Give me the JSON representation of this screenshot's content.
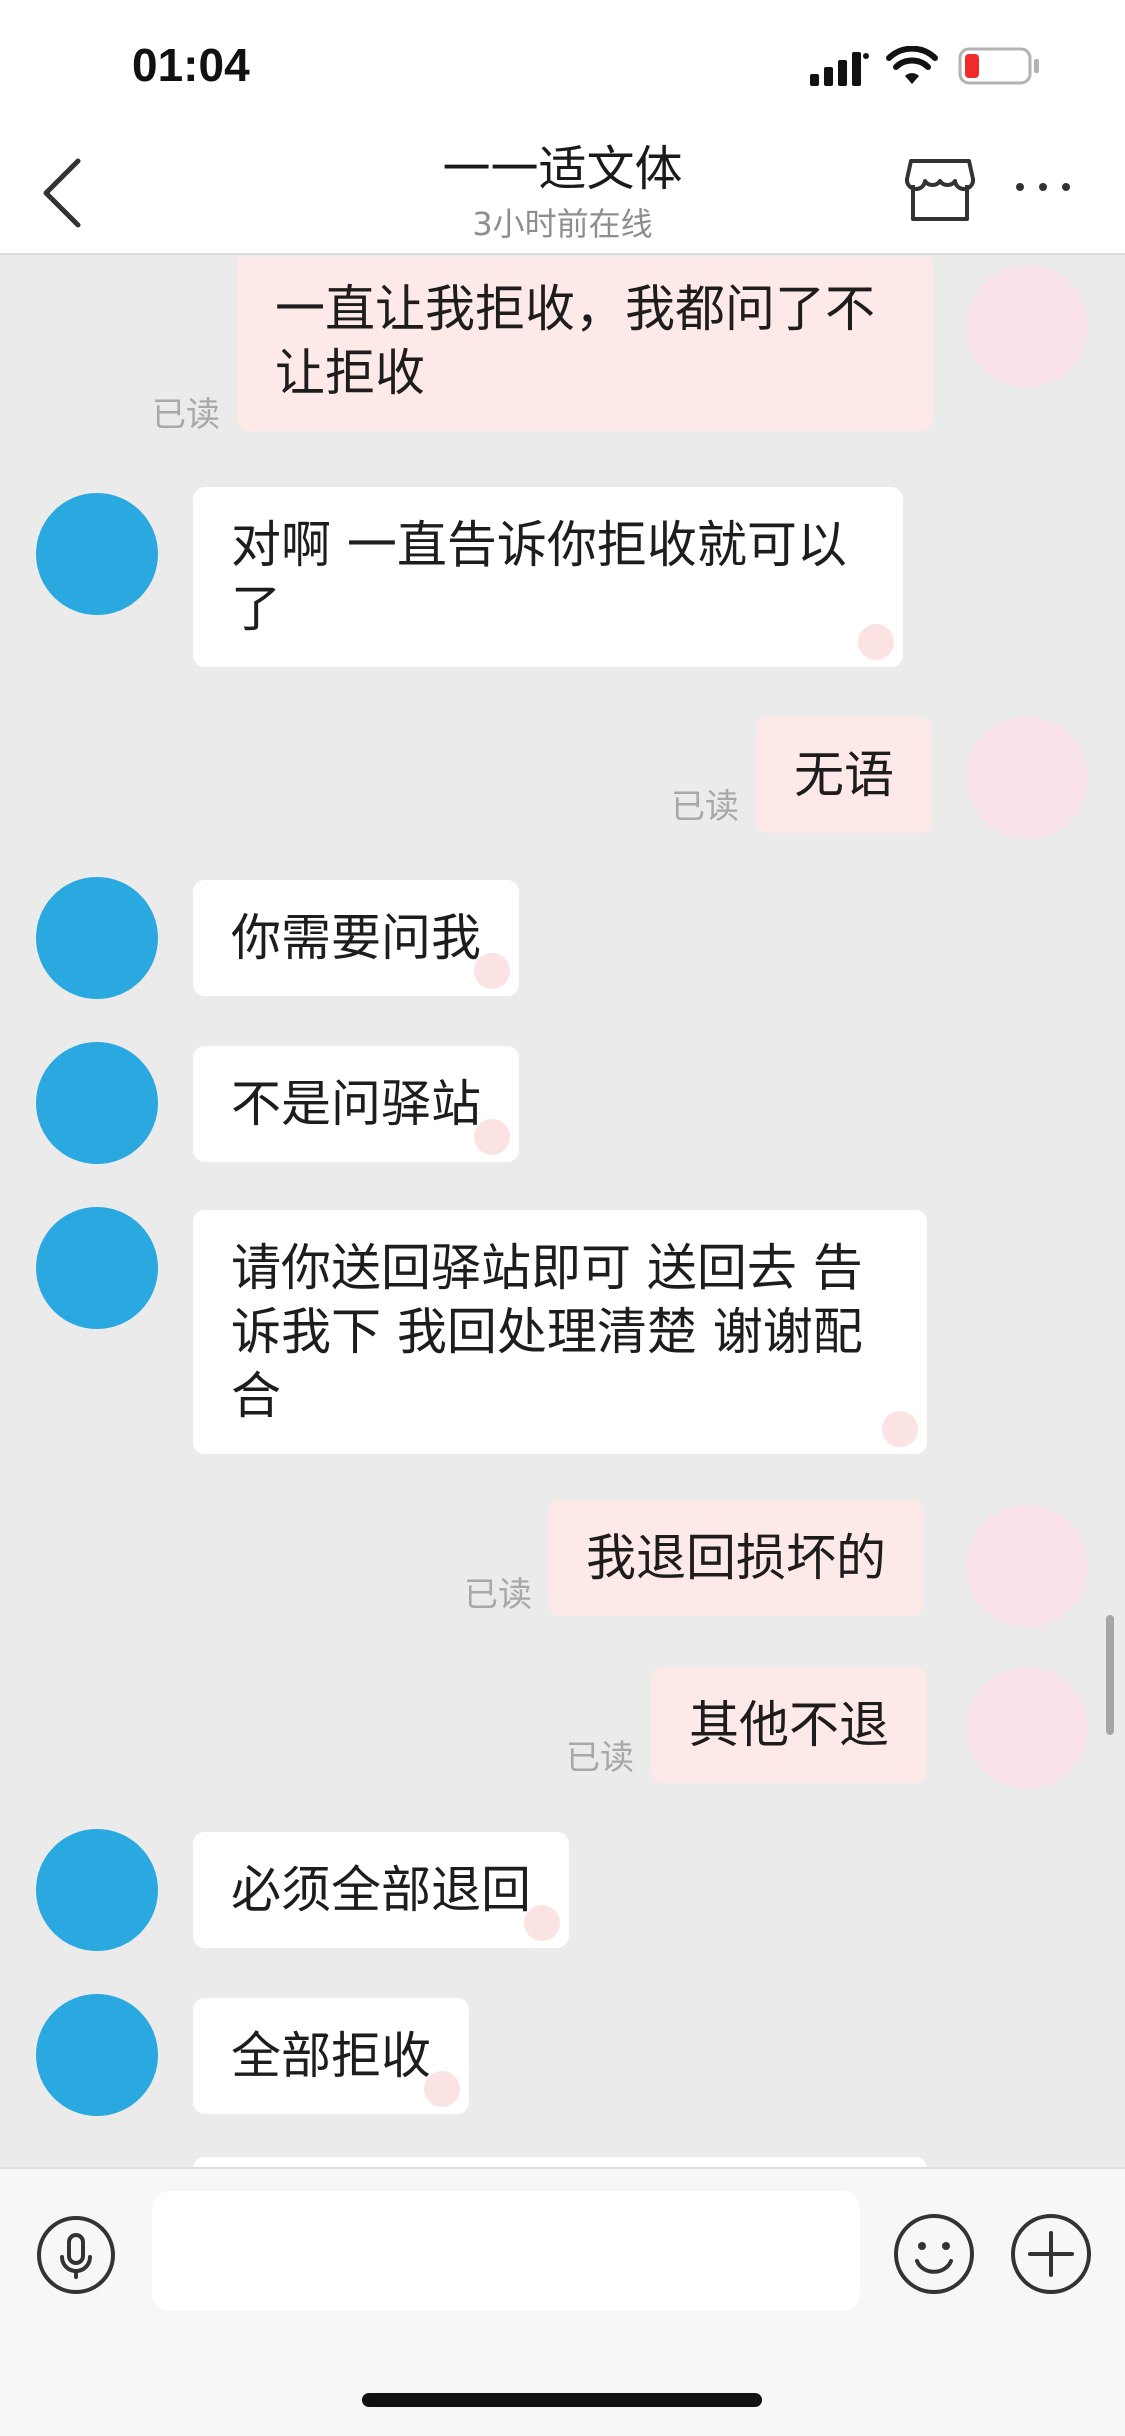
{
  "status_bar": {
    "time": "01:04"
  },
  "header": {
    "title": "一一适文体",
    "subtitle": "3小时前在线"
  },
  "read_label": "已读",
  "messages": [
    {
      "direction": "out",
      "text": "一直让我拒收，我都问了不让拒收",
      "read": "已读"
    },
    {
      "direction": "in",
      "text": "对啊 一直告诉你拒收就可以了"
    },
    {
      "direction": "out",
      "text": "无语",
      "read": "已读"
    },
    {
      "direction": "in",
      "text": "你需要问我"
    },
    {
      "direction": "in",
      "text": "不是问驿站"
    },
    {
      "direction": "in",
      "text": "请你送回驿站即可  送回去 告诉我下  我回处理清楚  谢谢配合"
    },
    {
      "direction": "out",
      "text": "我退回损坏的",
      "read": "已读"
    },
    {
      "direction": "out",
      "text": "其他不退",
      "read": "已读"
    },
    {
      "direction": "in",
      "text": "必须全部退回"
    },
    {
      "direction": "in",
      "text": "全部拒收"
    }
  ],
  "input": {
    "placeholder": "",
    "value": ""
  },
  "colors": {
    "out_bubble": "#fde9e7",
    "in_bubble": "#ffffff",
    "avatar_blue": "#2aa8e0",
    "chat_background": "#ebebeb"
  },
  "icons": [
    "back-icon",
    "shop-icon",
    "more-icon",
    "microphone-icon",
    "emoji-icon",
    "plus-icon",
    "signal-icon",
    "wifi-icon",
    "battery-icon"
  ]
}
